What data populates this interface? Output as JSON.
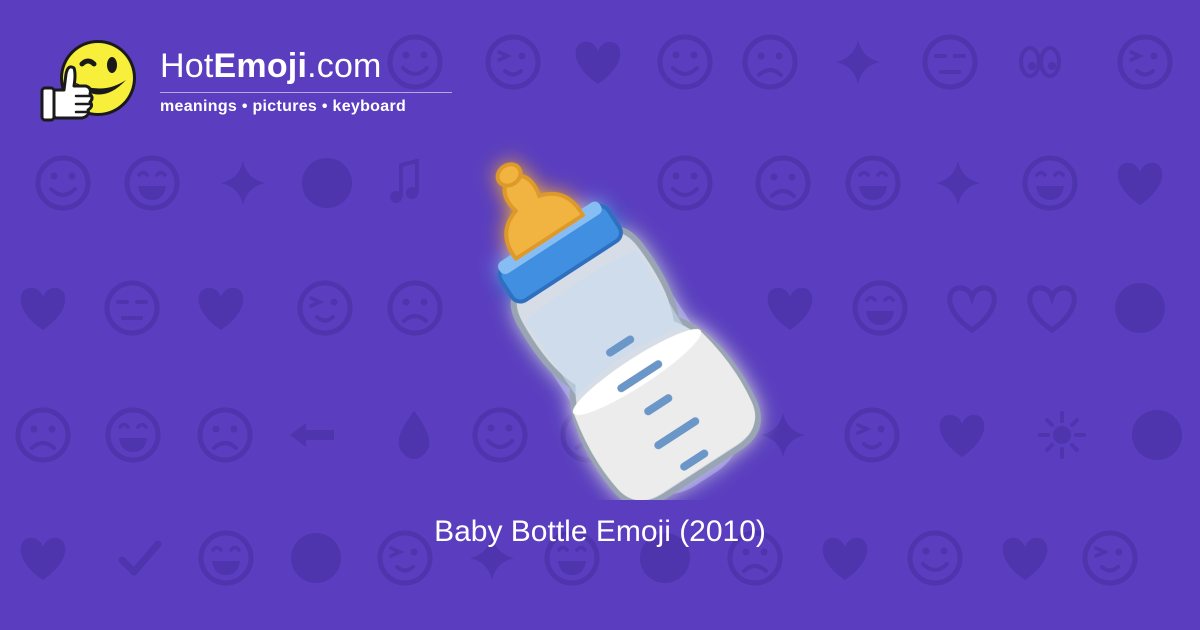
{
  "brand": {
    "name_light_1": "Hot",
    "name_bold": "Emoji",
    "name_light_2": ".com",
    "tagline": "meanings • pictures • keyboard"
  },
  "main_emoji": {
    "icon": "baby-bottle-icon"
  },
  "caption": "Baby Bottle Emoji (2010)",
  "background": {
    "pattern_icons": [
      "face-icons",
      "heart-icons",
      "hand-icons",
      "misc-emoji-icons"
    ]
  },
  "colors": {
    "background": "#5a3ebf",
    "pattern_icon": "#4e34ad",
    "text": "#ffffff",
    "mascot_yellow": "#f7ef3a",
    "bottle_cap": "#3f8fe0",
    "nipple": "#f2b441",
    "milk": "#e8e8e8"
  }
}
